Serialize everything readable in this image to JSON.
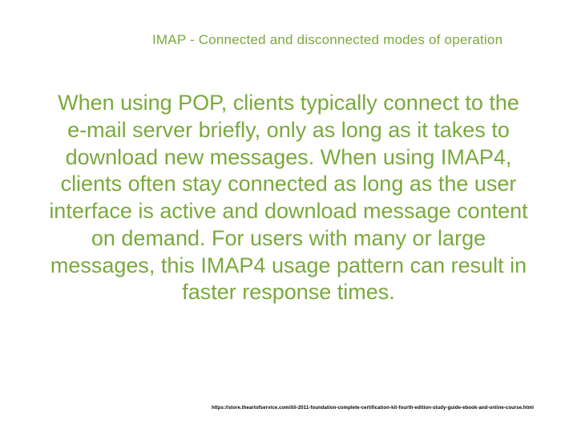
{
  "slide": {
    "title": "IMAP - Connected and disconnected modes of operation",
    "body": "When using POP, clients typically connect to the e-mail server briefly, only as long as it takes to download new messages.  When using IMAP4, clients often stay connected as long as the user interface is active and download message content on demand.  For users with many or large messages, this IMAP4 usage pattern can result in faster response times.",
    "footer": "https://store.theartofservice.com/itil-2011-foundation-complete-certification-kit-fourth-edition-study-guide-ebook-and-online-course.html"
  }
}
